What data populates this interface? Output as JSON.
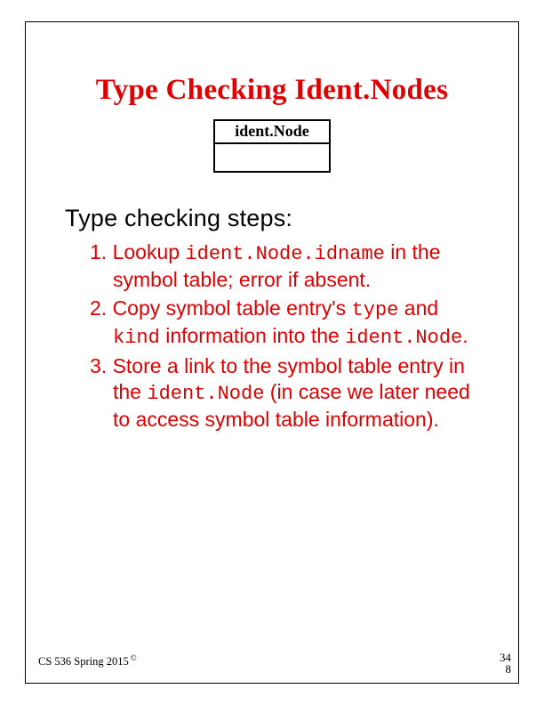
{
  "title": "Type Checking Ident.Nodes",
  "nodebox_label": "ident.Node",
  "subtitle": "Type checking steps:",
  "step1_num": "1. Lookup ",
  "step1_code": "ident.Node.idname",
  "step1_tail": " in the symbol table; error if absent.",
  "step2_num": "2. Copy symbol table entry's ",
  "step2_code_a": "type",
  "step2_mid": " and ",
  "step2_code_b": "kind",
  "step2_tail": " information into the ",
  "step2_code_c": "ident.Node",
  "step2_period": ".",
  "step3_num": "3. Store a link to the symbol table entry in the ",
  "step3_code": "ident.Node",
  "step3_tail": " (in case we later need to access symbol table information).",
  "footer_course": "CS 536  Spring 2015",
  "footer_copy": "©",
  "page_num_a": "34",
  "page_num_b": "8"
}
